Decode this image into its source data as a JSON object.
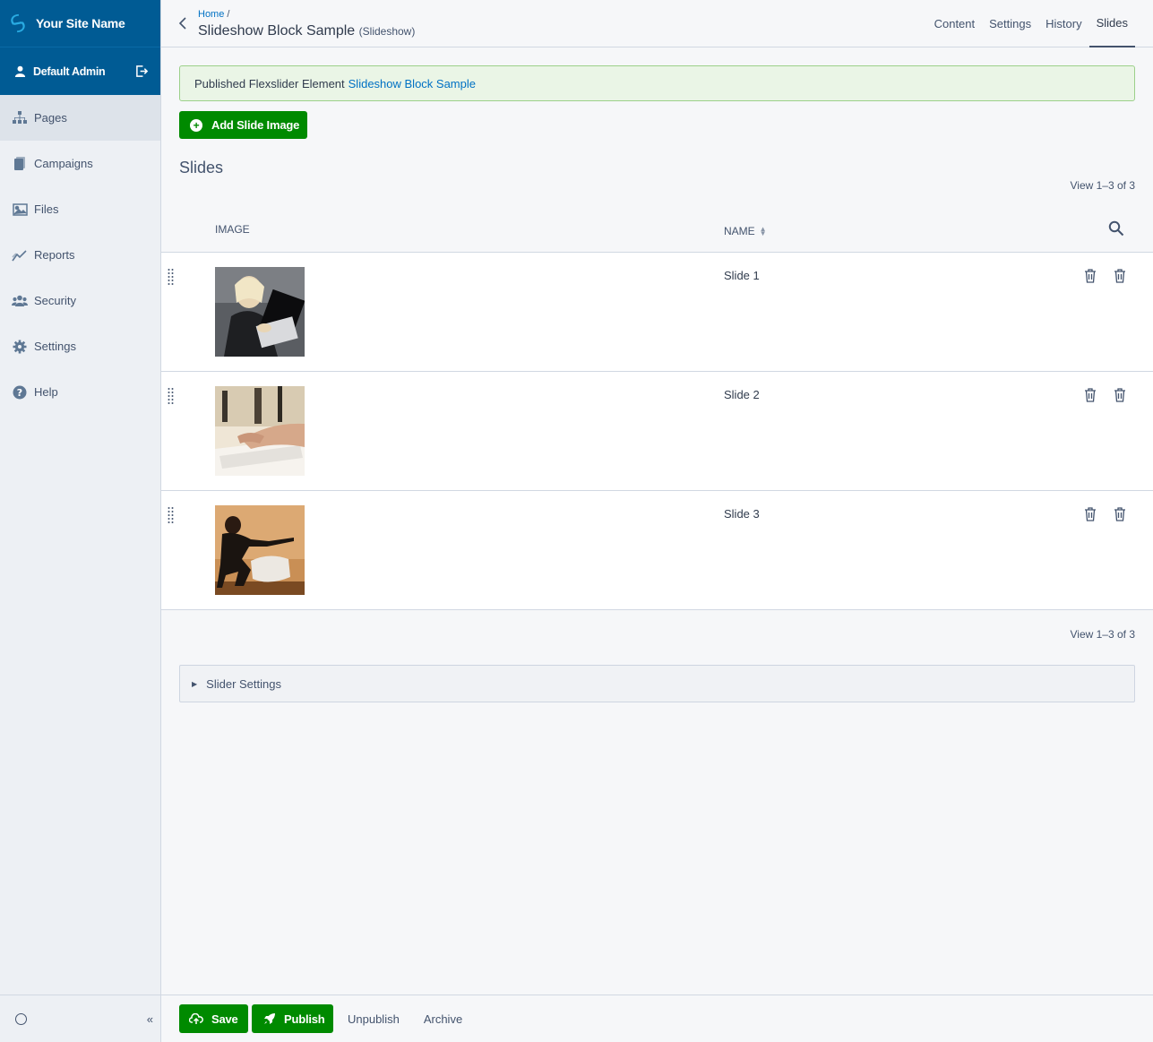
{
  "brand": {
    "site_name": "Your Site Name"
  },
  "user": {
    "name": "Default Admin"
  },
  "nav": [
    {
      "label": "Pages",
      "icon": "sitemap-icon"
    },
    {
      "label": "Campaigns",
      "icon": "campaigns-icon"
    },
    {
      "label": "Files",
      "icon": "image-icon"
    },
    {
      "label": "Reports",
      "icon": "chart-line-icon"
    },
    {
      "label": "Security",
      "icon": "users-icon"
    },
    {
      "label": "Settings",
      "icon": "gear-icon"
    },
    {
      "label": "Help",
      "icon": "help-icon"
    }
  ],
  "sidebar_footer": {
    "collapse_label": "«"
  },
  "header": {
    "breadcrumb": "Home",
    "breadcrumb_sep": "/",
    "title": "Slideshow Block Sample",
    "subtitle": "(Slideshow)",
    "tabs": [
      "Content",
      "Settings",
      "History",
      "Slides"
    ]
  },
  "alert": {
    "text": "Published Flexslider Element",
    "link": "Slideshow Block Sample"
  },
  "add_button": {
    "label": "Add Slide Image"
  },
  "section": {
    "title": "Slides"
  },
  "grid": {
    "view_count": "View 1–3 of 3",
    "columns": {
      "image": "IMAGE",
      "name": "NAME"
    },
    "rows": [
      {
        "name": "Slide 1"
      },
      {
        "name": "Slide 2"
      },
      {
        "name": "Slide 3"
      }
    ]
  },
  "accordion": {
    "label": "Slider Settings"
  },
  "footer": {
    "save": "Save",
    "publish": "Publish",
    "unpublish": "Unpublish",
    "archive": "Archive"
  },
  "colors": {
    "brand": "#005b94",
    "accent_green": "#008a00",
    "link": "#0071c4"
  }
}
